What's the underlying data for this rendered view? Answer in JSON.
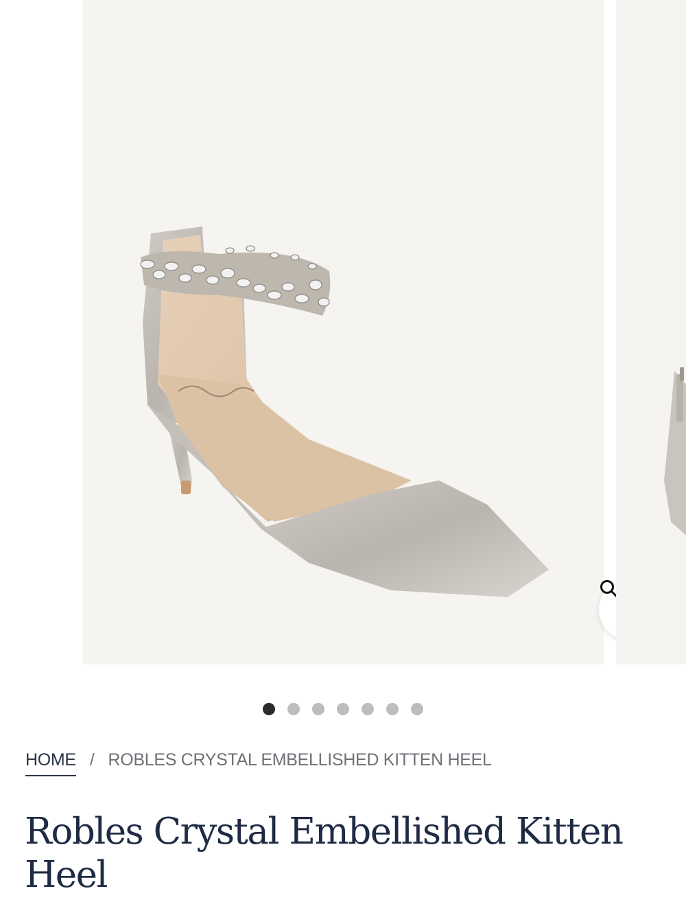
{
  "gallery": {
    "slide_count": 7,
    "active_slide": 1,
    "background": "#f6f4f0",
    "zoom_icon": "search-icon"
  },
  "breadcrumb": {
    "home_label": "HOME",
    "separator": "/",
    "current_label": "ROBLES CRYSTAL EMBELLISHED KITTEN HEEL"
  },
  "product": {
    "title": "Robles Crystal Embellished Kitten Heel"
  },
  "colors": {
    "title_navy": "#1f2a44",
    "dot_active": "#2b2b2b",
    "dot_inactive": "#bdbdbd"
  }
}
